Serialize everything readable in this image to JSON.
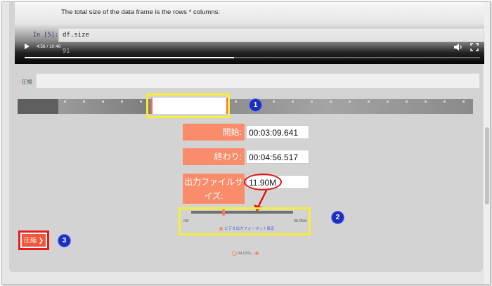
{
  "notebook": {
    "text": "The total size of the data frame is the rows * columns:",
    "prompt": "In [5]:",
    "code": "df.size",
    "output": "91"
  },
  "video": {
    "time": "4:56 / 10:46",
    "progress_fraction": 0.46
  },
  "form": {
    "name_label": "圧縮",
    "start_label": "開始:",
    "start_value": "00:03:09.641",
    "end_label": "終わり:",
    "end_value": "00:04:56.517",
    "size_label": "出力ファイルサイズ:",
    "size_value": "11.90M",
    "size_min": "0M",
    "size_max": "36.05M",
    "size_link": "ビデオ出力フォーマット設定"
  },
  "compress_button": {
    "label": "圧縮"
  },
  "footer": {
    "text": "94.05%..."
  },
  "badges": [
    "1",
    "2",
    "3"
  ]
}
